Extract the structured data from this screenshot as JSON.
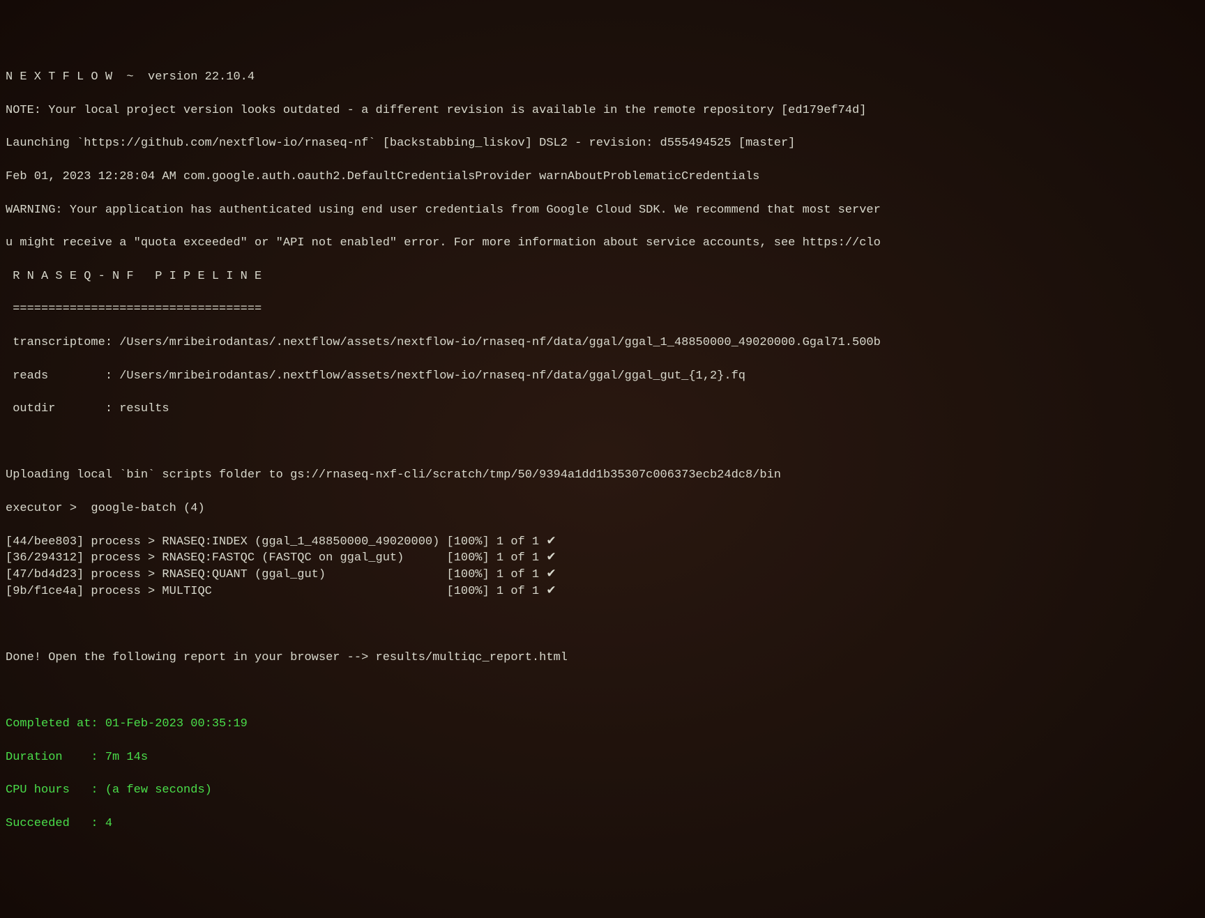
{
  "header": {
    "nextflow": "N E X T F L O W  ~  version 22.10.4",
    "note": "NOTE: Your local project version looks outdated - a different revision is available in the remote repository [ed179ef74d]",
    "launching": "Launching `https://github.com/nextflow-io/rnaseq-nf` [backstabbing_liskov] DSL2 - revision: d555494525 [master]",
    "timestamp": "Feb 01, 2023 12:28:04 AM com.google.auth.oauth2.DefaultCredentialsProvider warnAboutProblematicCredentials",
    "warning": "WARNING: Your application has authenticated using end user credentials from Google Cloud SDK. We recommend that most server",
    "warning2": "u might receive a \"quota exceeded\" or \"API not enabled\" error. For more information about service accounts, see https://clo"
  },
  "pipeline": {
    "title": " R N A S E Q - N F   P I P E L I N E",
    "divider": " ===================================",
    "transcriptome": " transcriptome: /Users/mribeirodantas/.nextflow/assets/nextflow-io/rnaseq-nf/data/ggal/ggal_1_48850000_49020000.Ggal71.500b",
    "reads": " reads        : /Users/mribeirodantas/.nextflow/assets/nextflow-io/rnaseq-nf/data/ggal/ggal_gut_{1,2}.fq",
    "outdir": " outdir       : results"
  },
  "upload": "Uploading local `bin` scripts folder to gs://rnaseq-nxf-cli/scratch/tmp/50/9394a1dd1b35307c006373ecb24dc8/bin",
  "executor": "executor >  google-batch (4)",
  "processes": [
    {
      "id": "[44/bee803]",
      "name": "RNASEQ:INDEX (ggal_1_48850000_49020000)",
      "pct": "[100%]",
      "status": "1 of 1",
      "check": "✔"
    },
    {
      "id": "[36/294312]",
      "name": "RNASEQ:FASTQC (FASTQC on ggal_gut)",
      "pct": "[100%]",
      "status": "1 of 1",
      "check": "✔"
    },
    {
      "id": "[47/bd4d23]",
      "name": "RNASEQ:QUANT (ggal_gut)",
      "pct": "[100%]",
      "status": "1 of 1",
      "check": "✔"
    },
    {
      "id": "[9b/f1ce4a]",
      "name": "MULTIQC",
      "pct": "[100%]",
      "status": "1 of 1",
      "check": "✔"
    }
  ],
  "done": "Done! Open the following report in your browser --> results/multiqc_report.html",
  "summary": {
    "completed": "Completed at: 01-Feb-2023 00:35:19",
    "duration": "Duration    : 7m 14s",
    "cpu": "CPU hours   : (a few seconds)",
    "succeeded": "Succeeded   : 4"
  }
}
